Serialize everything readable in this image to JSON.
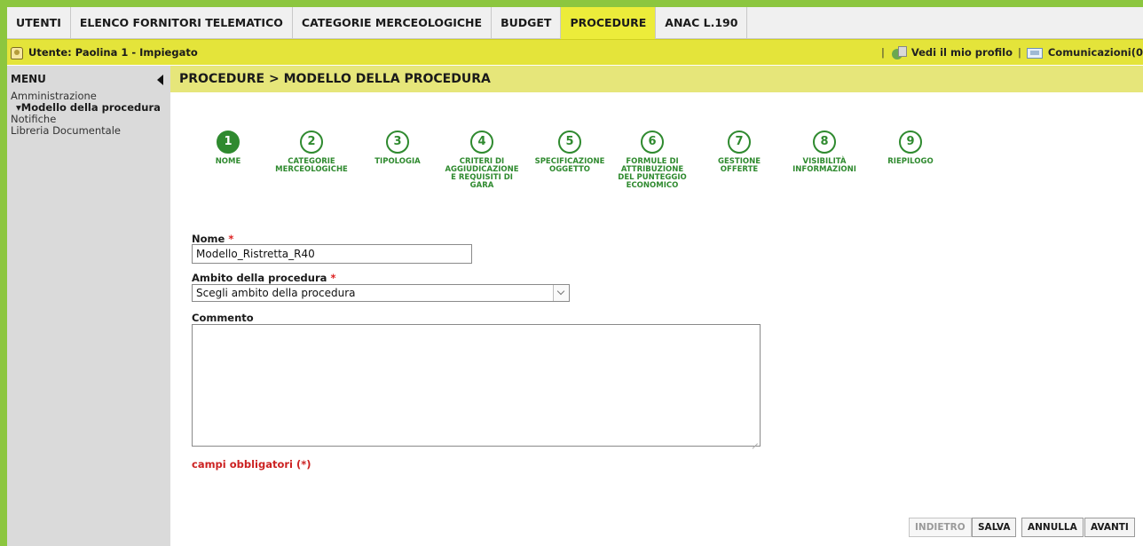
{
  "top_nav": {
    "tabs": [
      {
        "label": "UTENTI",
        "active": false
      },
      {
        "label": "ELENCO FORNITORI TELEMATICO",
        "active": false
      },
      {
        "label": "CATEGORIE MERCEOLOGICHE",
        "active": false
      },
      {
        "label": "BUDGET",
        "active": false
      },
      {
        "label": "PROCEDURE",
        "active": true
      },
      {
        "label": "ANAC L.190",
        "active": false
      }
    ]
  },
  "user_bar": {
    "user_label": "Utente: Paolina 1 - Impiegato",
    "separator": "|",
    "profile_link": "Vedi il mio profilo",
    "comms_link": "Comunicazioni(0"
  },
  "sidebar": {
    "title": "MENU",
    "items": [
      {
        "label": "Amministrazione"
      },
      {
        "label": "▾Modello della procedura"
      },
      {
        "label": "Notifiche"
      },
      {
        "label": "Libreria Documentale"
      }
    ]
  },
  "header": {
    "breadcrumb": "PROCEDURE  > MODELLO DELLA PROCEDURA"
  },
  "stepper": {
    "steps": [
      {
        "number": "1",
        "label": "NOME",
        "active": true
      },
      {
        "number": "2",
        "label": "CATEGORIE MERCEOLOGICHE",
        "active": false
      },
      {
        "number": "3",
        "label": "TIPOLOGIA",
        "active": false
      },
      {
        "number": "4",
        "label": "CRITERI DI AGGIUDICAZIONE E REQUISITI DI GARA",
        "active": false
      },
      {
        "number": "5",
        "label": "SPECIFICAZIONE OGGETTO",
        "active": false
      },
      {
        "number": "6",
        "label": "FORMULE DI ATTRIBUZIONE DEL PUNTEGGIO ECONOMICO",
        "active": false
      },
      {
        "number": "7",
        "label": "GESTIONE OFFERTE",
        "active": false
      },
      {
        "number": "8",
        "label": "VISIBILITÀ INFORMAZIONI",
        "active": false
      },
      {
        "number": "9",
        "label": "RIEPILOGO",
        "active": false
      }
    ]
  },
  "form": {
    "nome_label": "Nome",
    "nome_value": "Modello_Ristretta_R40",
    "ambito_label": "Ambito della procedura",
    "ambito_selected": "Scegli ambito della procedura",
    "commento_label": "Commento",
    "commento_value": "",
    "required_mark": "*",
    "required_note": "campi obbligatori (*)"
  },
  "buttons": {
    "back": "INDIETRO",
    "save": "SALVA",
    "cancel": "ANNULLA",
    "next": "AVANTI"
  },
  "colors": {
    "frame_green": "#8cc63f",
    "active_tab": "#ecec3a",
    "user_bar": "#e4e43a",
    "path_bar": "#e6e67a",
    "step_green": "#2f8a2f",
    "required_red": "#cc2222"
  }
}
